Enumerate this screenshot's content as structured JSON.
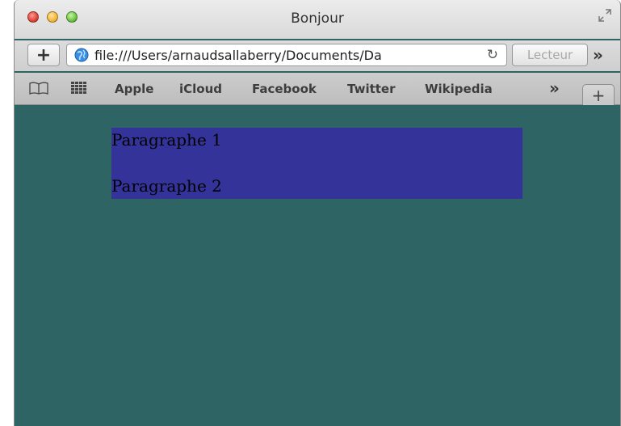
{
  "window": {
    "title": "Bonjour"
  },
  "toolbar": {
    "new_tab_symbol": "+",
    "url": "file:///Users/arnaudsallaberry/Documents/Da",
    "reload_symbol": "↻",
    "reader_label": "Lecteur",
    "more_symbol": "»"
  },
  "bookmarks": {
    "items": [
      "Apple",
      "iCloud",
      "Facebook",
      "Twitter",
      "Wikipedia"
    ],
    "more_symbol": "»",
    "new_tab_symbol": "+"
  },
  "page": {
    "paragraphs": [
      "Paragraphe 1",
      "Paragraphe 2"
    ],
    "colors": {
      "page_background": "#2f6464",
      "box_background": "#33339a"
    }
  }
}
